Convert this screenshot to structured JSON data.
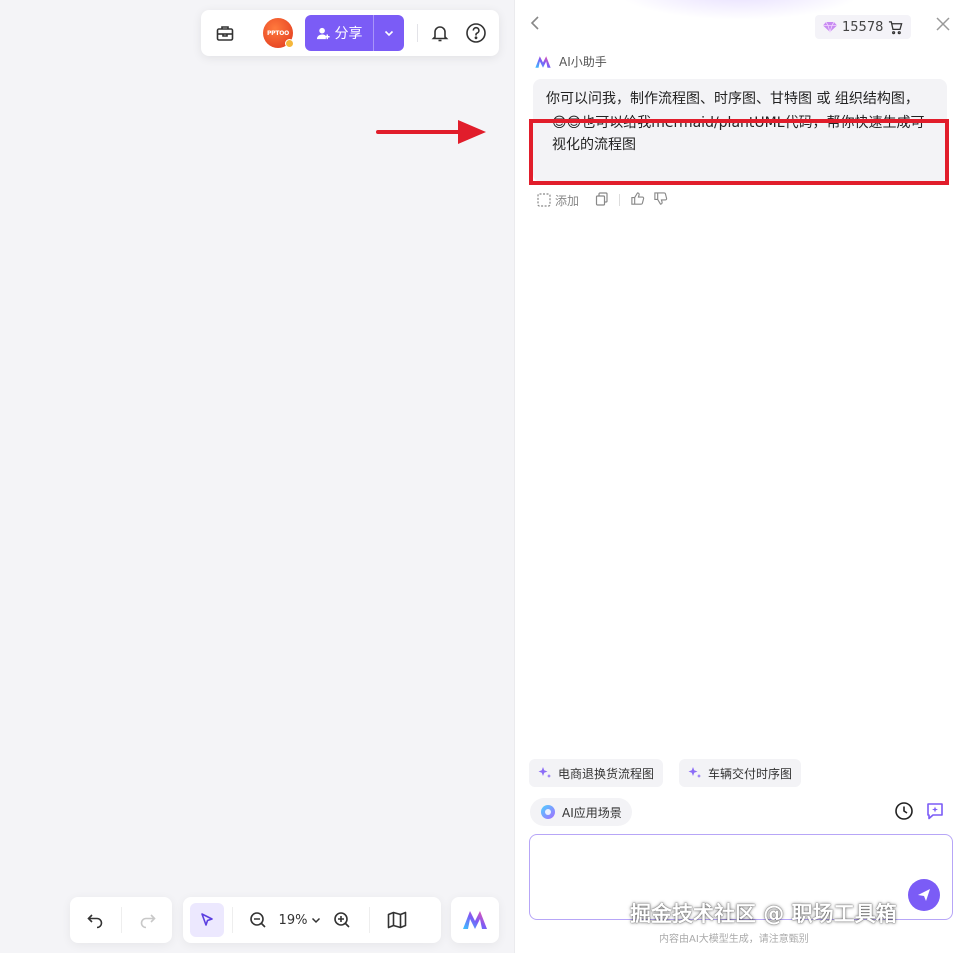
{
  "top_toolbar": {
    "avatar_text": "PPTOO",
    "share_label": "分享"
  },
  "bottom_toolbar": {
    "zoom": "19%"
  },
  "panel": {
    "credits": "15578",
    "assistant_name": "AI小助手",
    "message": {
      "line1": "你可以问我，制作流程图、时序图、甘特图 或 组织结构图，",
      "emoji": "😎😎",
      "line2": "也可以给我mermaid/plantUML代码，帮你快速生成可视化的流程图"
    },
    "actions": {
      "add_label": "添加"
    },
    "suggestions": [
      "电商退换货流程图",
      "车辆交付时序图"
    ],
    "ai_scene_label": "AI应用场景",
    "input_placeholder": "",
    "disclaimer": "内容由AI大模型生成，请注意甄别"
  },
  "watermark": "掘金技术社区 @ 职场工具箱",
  "colors": {
    "accent": "#7b5cf6",
    "highlight": "#e11d2b",
    "canvas": "#f4f4f7"
  },
  "icons": [
    "toolbox-icon",
    "bell-icon",
    "help-icon",
    "undo-icon",
    "redo-icon",
    "cursor-icon",
    "zoom-out-icon",
    "zoom-in-icon",
    "map-icon",
    "ai-logo-icon",
    "back-icon",
    "gem-icon",
    "cart-icon",
    "close-icon",
    "copy-icon",
    "thumbs-up-icon",
    "thumbs-down-icon",
    "sparkle-icon",
    "history-icon",
    "new-chat-icon",
    "send-icon"
  ]
}
